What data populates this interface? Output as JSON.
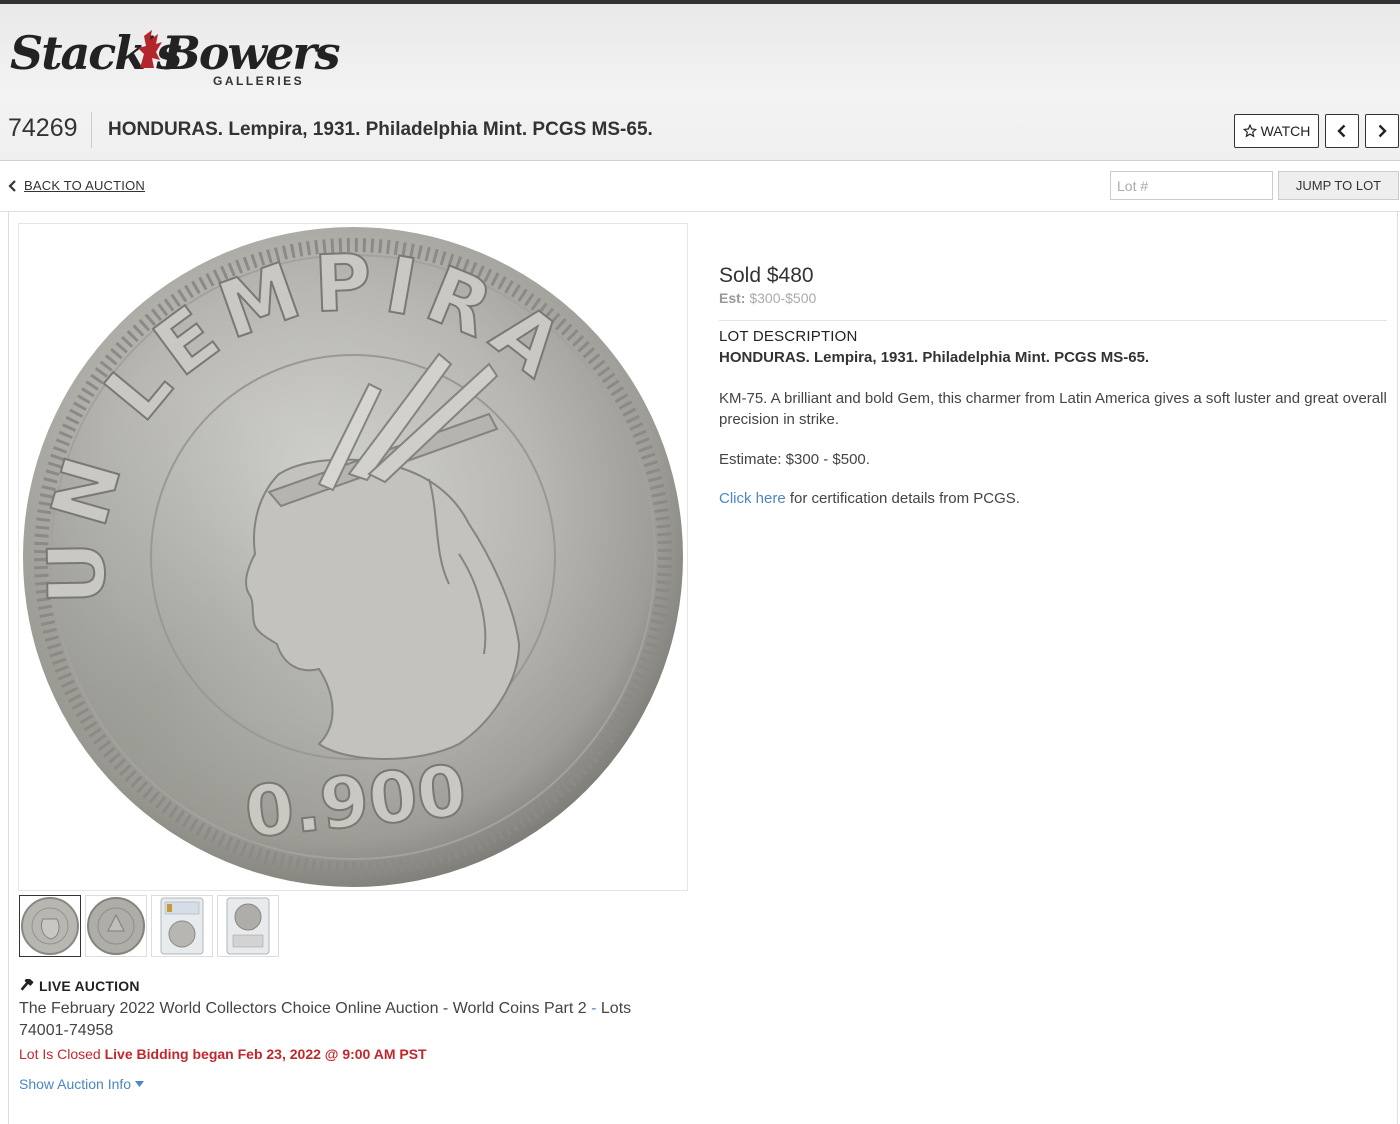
{
  "brand": {
    "logo_left": "Stack's",
    "logo_right": "Bowers",
    "logo_sub": "GALLERIES"
  },
  "header": {
    "lot_number": "74269",
    "lot_title": "HONDURAS. Lempira, 1931. Philadelphia Mint. PCGS MS-65.",
    "watch_label": "WATCH"
  },
  "subbar": {
    "back_label": "BACK TO AUCTION",
    "lot_placeholder": "Lot #",
    "jump_label": "JUMP TO LOT"
  },
  "coin": {
    "legend": "UN LEMPIRA",
    "fineness": "0.900"
  },
  "thumbnails": [
    {
      "name": "obverse"
    },
    {
      "name": "reverse"
    },
    {
      "name": "slab-front"
    },
    {
      "name": "slab-back"
    }
  ],
  "auction": {
    "type_label": "LIVE AUCTION",
    "name": "The February 2022 World Collectors Choice Online Auction - World Coins Part 2",
    "lots_sep": " - ",
    "lots": "Lots 74001-74958",
    "closed_label": "Lot Is Closed",
    "bidding_began": "Live Bidding began Feb 23, 2022 @ 9:00 AM PST",
    "show_info_label": "Show Auction Info"
  },
  "pricing": {
    "sold": "Sold $480",
    "est_label": "Est:",
    "est_value": "$300-$500"
  },
  "description": {
    "heading": "LOT DESCRIPTION",
    "title": "HONDURAS. Lempira, 1931. Philadelphia Mint. PCGS MS-65.",
    "body": "KM-75. A brilliant and bold Gem, this charmer from Latin America gives a soft luster and great overall precision in strike.",
    "estimate": "Estimate: $300 - $500.",
    "cert_link": "Click here",
    "cert_text": " for certification details from PCGS."
  },
  "colors": {
    "link_blue": "#4a86c5",
    "status_red": "#c1272d",
    "header_bg": "#ececec"
  }
}
